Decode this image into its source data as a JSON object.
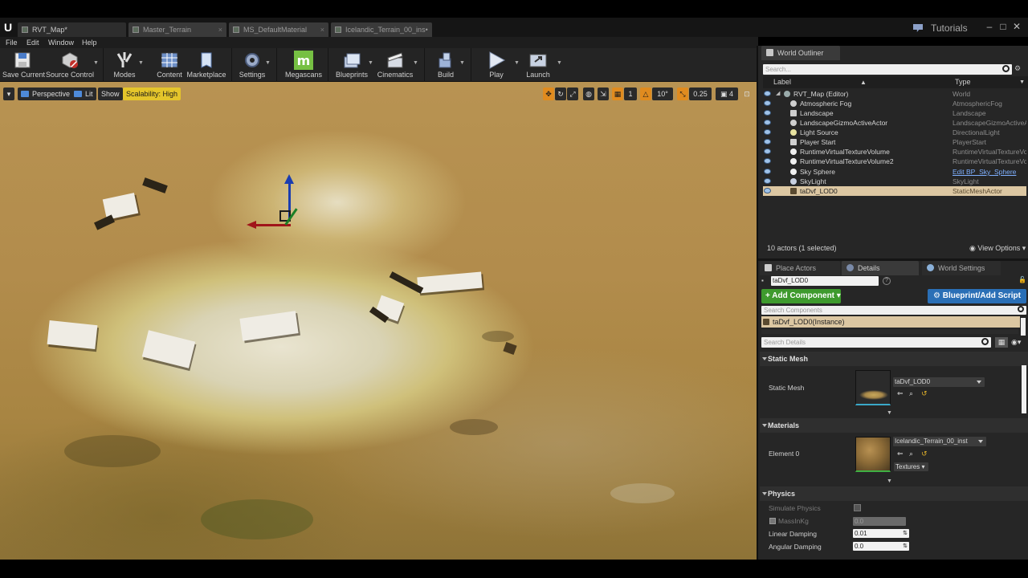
{
  "titlebar": {
    "tabs": [
      {
        "label": "RVT_Map*"
      },
      {
        "label": "Master_Terrain"
      },
      {
        "label": "MS_DefaultMaterial"
      },
      {
        "label": "Icelandic_Terrain_00_ins•"
      }
    ],
    "tutorials_label": "Tutorials",
    "window_buttons": [
      "–",
      "□",
      "✕"
    ]
  },
  "menu": {
    "items": [
      "File",
      "Edit",
      "Window",
      "Help"
    ]
  },
  "toolbar": {
    "save_current": "Save Current",
    "source_control": "Source Control",
    "modes": "Modes",
    "content": "Content",
    "marketplace": "Marketplace",
    "settings": "Settings",
    "megascans": "Megascans",
    "blueprints": "Blueprints",
    "cinematics": "Cinematics",
    "build": "Build",
    "play": "Play",
    "launch": "Launch"
  },
  "viewport": {
    "perspective": "Perspective",
    "lit": "Lit",
    "show": "Show",
    "scalability": "Scalability: High",
    "grid_snap": "1",
    "rotation_snap": "10°",
    "scale_snap": "0.25",
    "camera_speed": "4"
  },
  "world_outliner": {
    "tab_label": "World Outliner",
    "search_placeholder": "Search...",
    "col_label": "Label",
    "col_type": "Type",
    "rows": [
      {
        "label": "RVT_Map (Editor)",
        "type": "World"
      },
      {
        "label": "Atmospheric Fog",
        "type": "AtmosphericFog"
      },
      {
        "label": "Landscape",
        "type": "Landscape"
      },
      {
        "label": "LandscapeGizmoActiveActor",
        "type": "LandscapeGizmoActiveA"
      },
      {
        "label": "Light Source",
        "type": "DirectionalLight"
      },
      {
        "label": "Player Start",
        "type": "PlayerStart"
      },
      {
        "label": "RuntimeVirtualTextureVolume",
        "type": "RuntimeVirtualTextureVo"
      },
      {
        "label": "RuntimeVirtualTextureVolume2",
        "type": "RuntimeVirtualTextureVo"
      },
      {
        "label": "Sky Sphere",
        "type": "Edit BP_Sky_Sphere"
      },
      {
        "label": "SkyLight",
        "type": "SkyLight"
      },
      {
        "label": "taDvf_LOD0",
        "type": "StaticMeshActor"
      }
    ],
    "status": "10 actors (1 selected)",
    "view_options": "View Options"
  },
  "details": {
    "tabs": {
      "place_actors": "Place Actors",
      "details": "Details",
      "world_settings": "World Settings"
    },
    "name_value": "taDvf_LOD0",
    "add_component": "+ Add Component",
    "blueprint_script": "Blueprint/Add Script",
    "search_components_placeholder": "Search Components",
    "instance_row": "taDvf_LOD0(Instance)",
    "search_details_placeholder": "Search Details",
    "static_mesh_category": "Static Mesh",
    "static_mesh_label": "Static Mesh",
    "static_mesh_value": "taDvf_LOD0",
    "materials_category": "Materials",
    "element0_label": "Element 0",
    "element0_value": "Icelandic_Terrain_00_inst",
    "textures_label": "Textures",
    "physics_category": "Physics",
    "simulate_physics_label": "Simulate Physics",
    "mass_label": "MassInKg",
    "mass_value": "0.0",
    "linear_damping_label": "Linear Damping",
    "linear_damping_value": "0.01",
    "angular_damping_label": "Angular Damping",
    "angular_damping_value": "0.0"
  },
  "colors": {
    "selected_row": "#dcc7a2",
    "green_button": "#3e9a2d",
    "blue_button": "#2a6fb6",
    "scalability_yellow": "#e4c52b"
  }
}
